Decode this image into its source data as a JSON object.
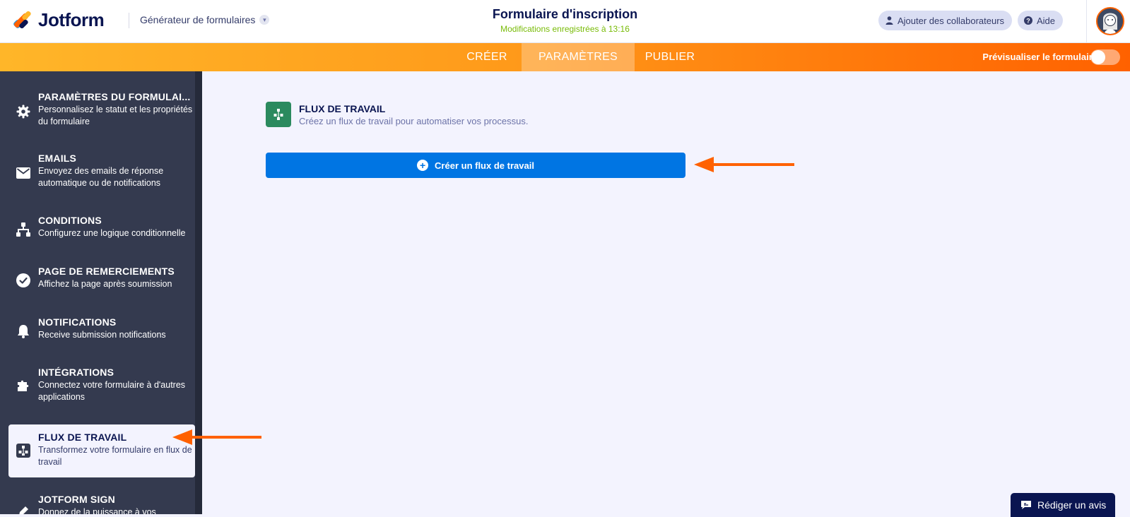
{
  "app": {
    "brand": "Jotform",
    "builder_menu": "Générateur de formulaires"
  },
  "header": {
    "form_title": "Formulaire d'inscription",
    "saved_status": "Modifications enregistrées à 13:16",
    "add_collaborators": "Ajouter des collaborateurs",
    "help": "Aide"
  },
  "tabs": [
    {
      "label": "CRÉER",
      "active": false
    },
    {
      "label": "PARAMÈTRES",
      "active": true
    },
    {
      "label": "PUBLIER",
      "active": false
    }
  ],
  "preview": {
    "label": "Prévisualiser le formulaire",
    "enabled": false
  },
  "sidebar": {
    "items": [
      {
        "title": "PARAMÈTRES DU FORMULAI...",
        "desc": "Personnalisez le statut et les propriétés du formulaire",
        "icon": "gear-icon"
      },
      {
        "title": "EMAILS",
        "desc": "Envoyez des emails de réponse automatique ou de notifications",
        "icon": "envelope-icon"
      },
      {
        "title": "CONDITIONS",
        "desc": "Configurez une logique conditionnelle",
        "icon": "hierarchy-icon"
      },
      {
        "title": "PAGE DE REMERCIEMENTS",
        "desc": "Affichez la page après soumission",
        "icon": "check-circle-icon"
      },
      {
        "title": "NOTIFICATIONS",
        "desc": "Receive submission notifications",
        "icon": "bell-icon"
      },
      {
        "title": "INTÉGRATIONS",
        "desc": "Connectez votre formulaire à d'autres applications",
        "icon": "puzzle-icon"
      },
      {
        "title": "FLUX DE TRAVAIL",
        "desc": "Transformez votre formulaire en flux de travail",
        "icon": "workflow-icon",
        "active": true
      },
      {
        "title": "JOTFORM SIGN",
        "desc": "Donnez de la puissance à vos",
        "icon": "pen-icon"
      }
    ]
  },
  "main": {
    "title": "FLUX DE TRAVAIL",
    "subtitle": "Créez un flux de travail pour automatiser vos processus.",
    "create_button": "Créer un flux de travail"
  },
  "feedback": {
    "label": "Rédiger un avis"
  },
  "colors": {
    "accent_orange": "#ff6100",
    "primary_blue": "#0075e3",
    "sidebar_bg": "#343a4f",
    "navy": "#0a1551",
    "saved_green": "#78bb07",
    "workflow_green": "#2b8a5e"
  }
}
